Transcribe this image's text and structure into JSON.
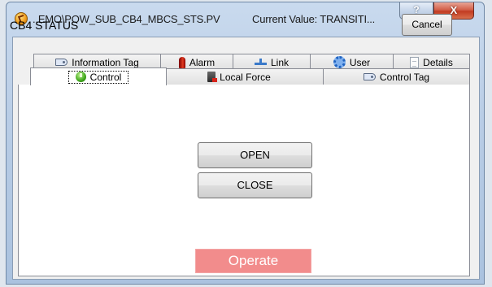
{
  "window": {
    "title": "..EMO\\POW_SUB_CB4_MBCS_STS.PV",
    "current_value": "Current Value: TRANSITI...",
    "help_label": "?",
    "close_label": "X"
  },
  "header": {
    "label": "CB4 STATUS",
    "cancel_label": "Cancel"
  },
  "tabs": {
    "row1": [
      {
        "label": "Information Tag",
        "icon": "tag-icon"
      },
      {
        "label": "Alarm",
        "icon": "alarm-icon"
      },
      {
        "label": "Link",
        "icon": "link-icon"
      },
      {
        "label": "User",
        "icon": "gear-icon"
      },
      {
        "label": "Details",
        "icon": "document-icon"
      }
    ],
    "row2": [
      {
        "label": "Control",
        "icon": "power-icon",
        "active": true
      },
      {
        "label": "Local Force",
        "icon": "local-force-icon"
      },
      {
        "label": "Control Tag",
        "icon": "tag-icon"
      }
    ]
  },
  "control": {
    "open_label": "OPEN",
    "close_label": "CLOSE",
    "operate_label": "Operate"
  },
  "colors": {
    "operate_bg": "#f28c8c",
    "close_button": "#c23b22",
    "frame": "#b9cde6"
  }
}
